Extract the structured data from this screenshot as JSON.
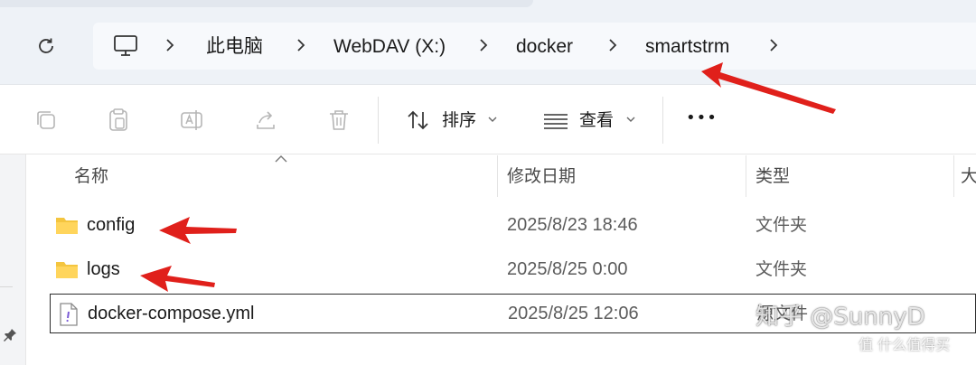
{
  "breadcrumb": {
    "items": [
      "此电脑",
      "WebDAV (X:)",
      "docker",
      "smartstrm"
    ]
  },
  "toolbar": {
    "sort_label": "排序",
    "view_label": "查看",
    "more_label": "•••"
  },
  "columns": {
    "name": "名称",
    "date": "修改日期",
    "type": "类型",
    "size": "大"
  },
  "files": [
    {
      "name": "config",
      "date": "2025/8/23 18:46",
      "type": "文件夹",
      "icon": "folder-icon"
    },
    {
      "name": "logs",
      "date": "2025/8/25 0:00",
      "type": "文件夹",
      "icon": "folder-icon"
    },
    {
      "name": "docker-compose.yml",
      "date": "2025/8/25 12:06",
      "type": "源文件",
      "icon": "file-icon"
    }
  ],
  "watermark": {
    "main": "知乎 @SunnyD",
    "secondary": "值 什么值得买"
  },
  "colors": {
    "accent_folder": "#f4c53f",
    "arrow": "#e0201b"
  }
}
